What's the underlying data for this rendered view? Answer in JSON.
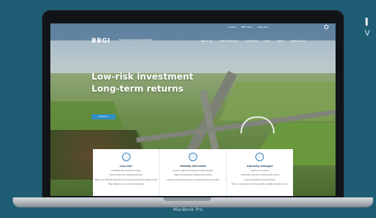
{
  "side": {
    "title": "I",
    "subtitle": "V"
  },
  "device": {
    "label": "MacBook Pro"
  },
  "site": {
    "logo": "BBGI",
    "logo_tagline": "INFRASTRUCTURE INVESTMENT",
    "top_links": [
      "Investors",
      "BBGI Share",
      "Share price"
    ],
    "nav": [
      "ABOUT US",
      "OUR PORTFOLIO",
      "INVESTORS",
      "ESG",
      "NEWS",
      "CONTACT US"
    ],
    "hero": {
      "title_line1": "Low-risk investment",
      "title_line2": "Long-term returns",
      "button": "FIND OUT"
    },
    "cards": [
      {
        "title": "Low-risk*",
        "lines": [
          "Availability-style investment strategy",
          "Diverse public sector (backed) revenues",
          "Stable and predictable cash flows with progressive long-term dividend growth",
          "*Note: Reference to 'low-risk' throughout this"
        ]
      },
      {
        "title": "Globally diversified",
        "lines": [
          "Focus on highly-rated investment grade countries",
          "Stable, well-developed operating environments",
          "A global portfolio serving society by supporting local communities"
        ]
      },
      {
        "title": "Internally managed",
        "lines": [
          "Alignment of interests",
          "Shareholder value first, portfolio growth second",
          "Lowest comparative ongoing charges*",
          "*Note: in comparison to the listed publicly available information as at..."
        ]
      }
    ]
  }
}
